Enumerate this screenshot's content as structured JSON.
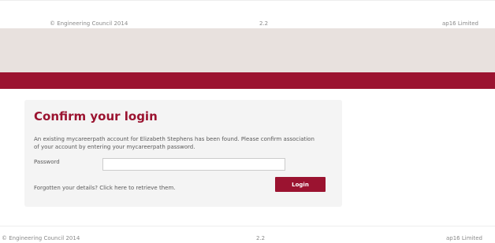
{
  "footer_top": {
    "copyright": "© Engineering Council 2014",
    "version": "2.2",
    "company": "ap16 Limited"
  },
  "login": {
    "title": "Confirm your login",
    "message": "An existing mycareerpath account for Elizabeth Stephens has been found. Please confirm association of your account by entering your mycareerpath password.",
    "password_label": "Password",
    "password_value": "",
    "forgot_text": "Forgotten your details? Click here to retrieve them.",
    "login_button": "Login"
  },
  "footer_bottom": {
    "copyright": "© Engineering Council 2014",
    "version": "2.2",
    "company": "ap16 Limited"
  },
  "colors": {
    "brand": "#9b1330",
    "band": "#e8e1de",
    "card": "#f4f4f4"
  }
}
